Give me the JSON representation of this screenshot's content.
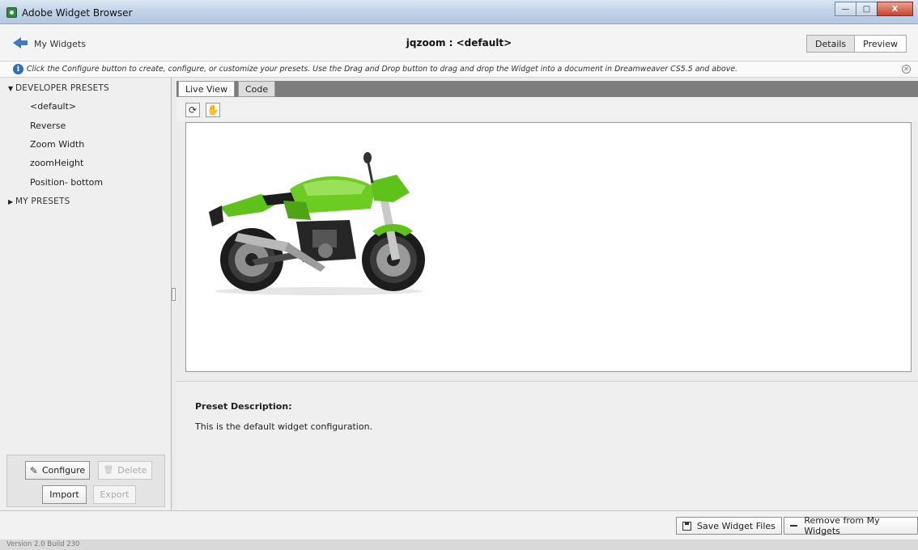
{
  "window": {
    "title": "Adobe Widget Browser",
    "controls": {
      "minimize": "—",
      "maximize": "□",
      "close": "X"
    }
  },
  "nav": {
    "back_label": "My Widgets",
    "page_title": "jqzoom : <default>",
    "view_toggle": [
      "Details",
      "Preview"
    ],
    "active_view": "Details"
  },
  "info": {
    "icon": "info-icon",
    "text": "Click the Configure button to create, configure, or customize your presets. Use the Drag and Drop button to drag and drop the Widget into a document in Dreamweaver CS5.5 and above."
  },
  "sidebar": {
    "developer_presets_label": "DEVELOPER PRESETS",
    "developer_presets": [
      "<default>",
      "Reverse",
      "Zoom Width",
      "zoomHeight",
      "Position- bottom"
    ],
    "my_presets_label": "MY PRESETS",
    "buttons": {
      "configure": "Configure",
      "delete": "Delete",
      "import": "Import",
      "export": "Export"
    }
  },
  "main": {
    "tabs": [
      "Live View",
      "Code"
    ],
    "active_tab": "Live View",
    "toolbar_icons": [
      "refresh-icon",
      "drag-drop-icon"
    ],
    "preview_image": "green motorcycle",
    "preset_description_title": "Preset Description:",
    "preset_description": "This is the default widget configuration."
  },
  "bottom": {
    "save_label": "Save Widget Files",
    "remove_label": "Remove from My Widgets"
  },
  "status": {
    "version": "Version 2.0 Build 230"
  },
  "colors": {
    "accent_blue": "#3d7ac6",
    "bike_green": "#5fc21a",
    "tab_bar": "#7d7d7d"
  }
}
